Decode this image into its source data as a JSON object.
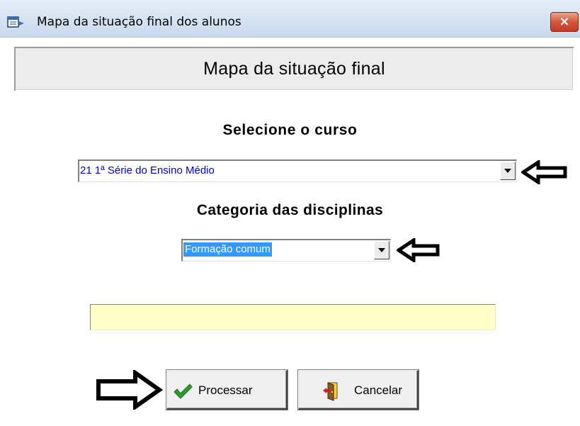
{
  "window": {
    "title": "Mapa da situação final dos alunos",
    "close_label": "×"
  },
  "header": {
    "title": "Mapa da situação final"
  },
  "course": {
    "label": "Selecione o curso",
    "selected": "21   1ª Série do Ensino Médio"
  },
  "category": {
    "label": "Categoria das disciplinas",
    "selected": "Formação comum"
  },
  "progress": {
    "value": 0
  },
  "buttons": {
    "process_label": "Processar",
    "cancel_label": "Cancelar"
  },
  "icons": {
    "app": "window-app-icon",
    "close": "close-icon",
    "dropdown": "chevron-down-icon",
    "pointer_left": "arrow-left-icon",
    "pointer_right": "arrow-right-icon",
    "process": "checkmark-icon",
    "cancel": "exit-door-icon"
  },
  "colors": {
    "course_text": "#0000cc",
    "selection_bg": "#3399ff",
    "progress_bg": "#ffffc8",
    "checkmark": "#2aa02a",
    "close_button": "#c9442a"
  }
}
